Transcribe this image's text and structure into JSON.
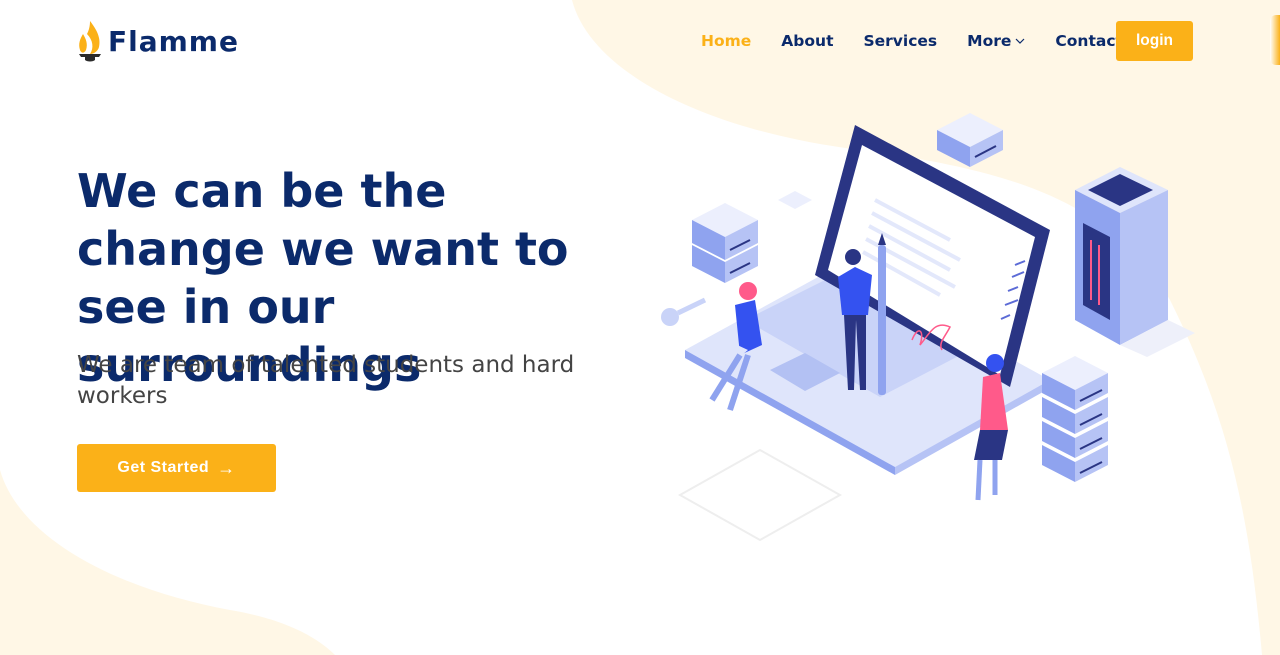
{
  "brand": {
    "name": "Flamme",
    "logo_icon": "flame-icon",
    "accent_color": "#fbb118",
    "primary_color": "#0b2a6b",
    "blob_color": "#fff7e6"
  },
  "nav": {
    "items": [
      {
        "label": "Home",
        "active": true
      },
      {
        "label": "About",
        "active": false
      },
      {
        "label": "Services",
        "active": false
      },
      {
        "label": "More",
        "active": false,
        "icon": "chevron-down-icon"
      },
      {
        "label": "Contact",
        "active": false
      }
    ],
    "login_label": "login"
  },
  "hero": {
    "title": "We can be the change we want to see in our surroundings",
    "subtitle": "We are team of talented students and hard workers",
    "cta_label": "Get Started",
    "cta_icon": "arrow-right-icon",
    "illustration": "isometric-laptop-team-illustration"
  }
}
